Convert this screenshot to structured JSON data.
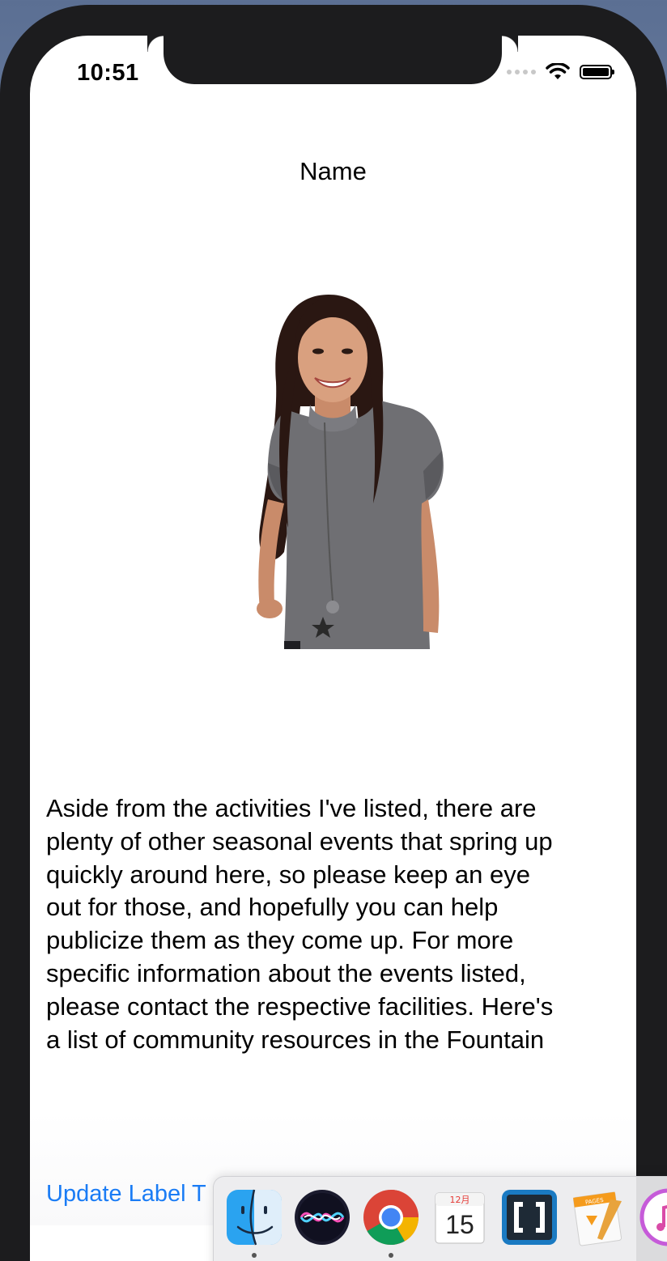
{
  "status_bar": {
    "time": "10:51"
  },
  "app": {
    "title": "Name",
    "body_text": "Aside from the activities I've listed, there are\nplenty of other seasonal events that spring up\nquickly around here, so please keep an eye\nout for those, and hopefully you can help\npublicize them as they come up. For more\nspecific information about the events listed,\nplease contact the respective facilities. Here's\na list of community resources in the Fountain",
    "update_button_label": "Update Label T"
  },
  "dock": {
    "items": [
      {
        "name": "Finder",
        "icon": "finder-icon",
        "running": true
      },
      {
        "name": "Siri",
        "icon": "siri-icon",
        "running": false
      },
      {
        "name": "Google Chrome",
        "icon": "chrome-icon",
        "running": true
      },
      {
        "name": "Calendar",
        "icon": "calendar-icon",
        "running": false,
        "month": "12月",
        "day": "15"
      },
      {
        "name": "Brackets",
        "icon": "brackets-icon",
        "running": false
      },
      {
        "name": "Pages",
        "icon": "pages-icon",
        "running": false,
        "label": "PAGES"
      },
      {
        "name": "iTunes",
        "icon": "itunes-icon",
        "running": false
      }
    ]
  },
  "colors": {
    "link_blue": "#1a7cf5",
    "phone_frame": "#1c1c1e"
  }
}
